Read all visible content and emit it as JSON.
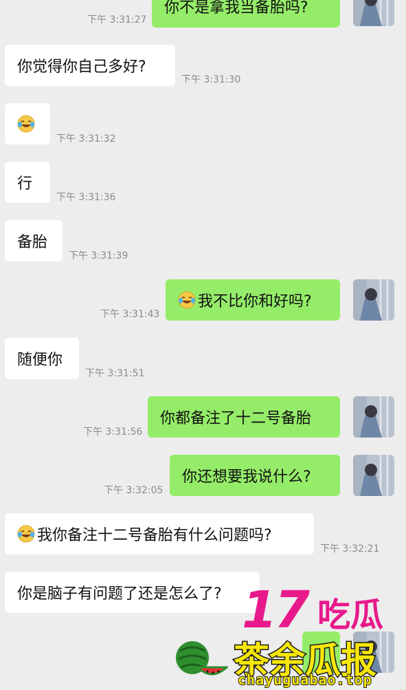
{
  "messages": [
    {
      "side": "right",
      "text": "你不是拿我当备胎吗?",
      "emoji": false,
      "time": "下午 3:31:27"
    },
    {
      "side": "left",
      "text": "你觉得你自己多好?",
      "emoji": false,
      "time": "下午 3:31:30"
    },
    {
      "side": "left",
      "text": "",
      "emoji": true,
      "time": "下午 3:31:32"
    },
    {
      "side": "left",
      "text": "行",
      "emoji": false,
      "time": "下午 3:31:36"
    },
    {
      "side": "left",
      "text": "备胎",
      "emoji": false,
      "time": "下午 3:31:39"
    },
    {
      "side": "right",
      "text": "我不比你和好吗?",
      "emoji": true,
      "time": "下午 3:31:43"
    },
    {
      "side": "left",
      "text": "随便你",
      "emoji": false,
      "time": "下午 3:31:51"
    },
    {
      "side": "right",
      "text": "你都备注了十二号备胎",
      "emoji": false,
      "time": "下午 3:31:56"
    },
    {
      "side": "right",
      "text": "你还想要我说什么?",
      "emoji": false,
      "time": "下午 3:32:05"
    },
    {
      "side": "left",
      "text": "我你备注十二号备胎有什么问题吗?",
      "emoji": true,
      "time": "下午 3:32:21"
    },
    {
      "side": "left",
      "text": "你是脑子有问题了还是怎么了?",
      "emoji": false,
      "time": ""
    }
  ],
  "watermark": {
    "logo_number": "17",
    "logo_word": "吃瓜",
    "title": "茶余瓜报",
    "url": "chayuguabao.top",
    "colors": {
      "magenta": "#e8198b",
      "yellow": "#f6e60a",
      "dark": "#1a1a1a"
    }
  },
  "colors": {
    "background": "#ededed",
    "left_bubble": "#ffffff",
    "right_bubble": "#95ec69",
    "timestamp": "#8a8a8a"
  }
}
